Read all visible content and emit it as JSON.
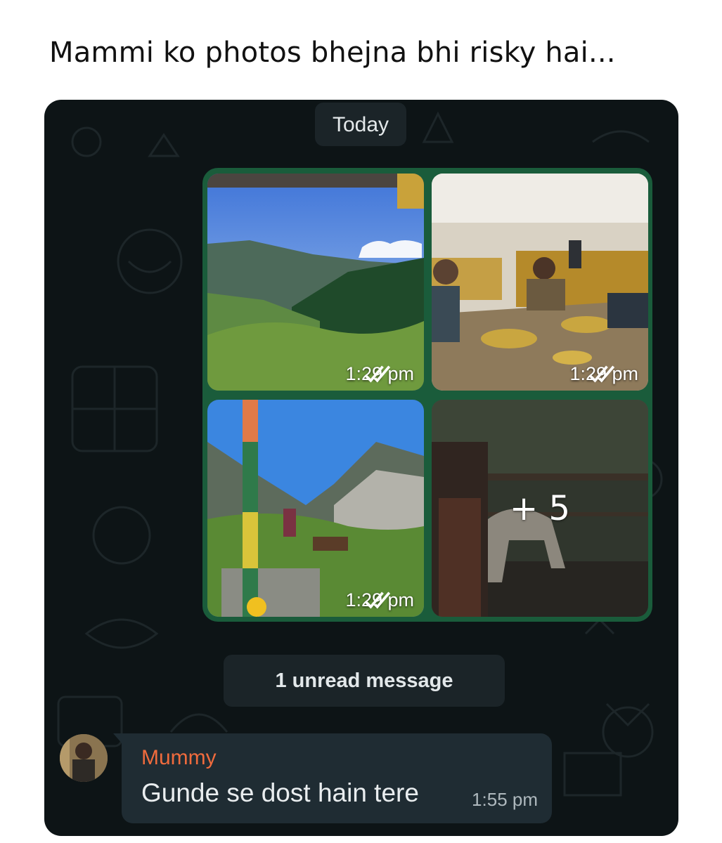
{
  "caption": "Mammi ko photos bhejna bhi risky hai...",
  "chat": {
    "date_separator": "Today",
    "photos": [
      {
        "time": "1:29 pm",
        "status": "read",
        "scene": "mountain valley"
      },
      {
        "time": "1:29 pm",
        "status": "read",
        "scene": "restaurant dinner"
      },
      {
        "time": "1:29 pm",
        "status": "read",
        "scene": "hillside with flags"
      },
      {
        "more_count": "+ 5",
        "scene": "dog on balcony"
      }
    ],
    "unread_banner": "1 unread message",
    "incoming_message": {
      "sender": "Mummy",
      "text": "Gunde se dost hain tere",
      "time": "1:55 pm"
    }
  },
  "colors": {
    "chat_bg": "#0d1416",
    "album_border": "#1a5c3b",
    "bubble_bg": "#1f2c33",
    "sender_name": "#f06b3d",
    "read_ticks": "#ffffff"
  },
  "icons": [
    "double-check-icon",
    "avatar"
  ]
}
